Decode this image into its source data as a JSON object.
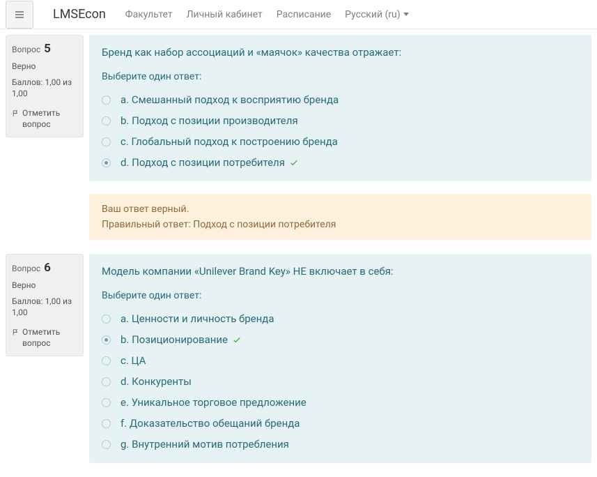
{
  "nav": {
    "brand": "LMSEcon",
    "links": {
      "faculty": "Факультет",
      "cabinet": "Личный кабинет",
      "schedule": "Расписание",
      "language": "Русский (ru)"
    }
  },
  "common": {
    "question_label": "Вопрос",
    "flag_label": "Отметить вопрос",
    "prompt": "Выберите один ответ:"
  },
  "questions": [
    {
      "number": "5",
      "status": "Верно",
      "score": "Баллов: 1,00 из 1,00",
      "text": "Бренд как набор ассоциаций и «маячок» качества отражает:",
      "options": [
        {
          "letter": "a.",
          "label": "Смешанный подход к восприятию бренда",
          "selected": false,
          "correct": false
        },
        {
          "letter": "b.",
          "label": "Подход с позиции производителя",
          "selected": false,
          "correct": false
        },
        {
          "letter": "c.",
          "label": "Глобальный подход к построению бренда",
          "selected": false,
          "correct": false
        },
        {
          "letter": "d.",
          "label": "Подход с позиции потребителя",
          "selected": true,
          "correct": true
        }
      ],
      "feedback": {
        "line1": "Ваш ответ верный.",
        "line2": "Правильный ответ: Подход с позиции потребителя"
      }
    },
    {
      "number": "6",
      "status": "Верно",
      "score": "Баллов: 1,00 из 1,00",
      "text": "Модель компании «Unilever Brand Key» НЕ включает в себя:",
      "options": [
        {
          "letter": "a.",
          "label": "Ценности и личность бренда",
          "selected": false,
          "correct": false
        },
        {
          "letter": "b.",
          "label": "Позиционирование",
          "selected": true,
          "correct": true
        },
        {
          "letter": "c.",
          "label": "ЦА",
          "selected": false,
          "correct": false
        },
        {
          "letter": "d.",
          "label": "Конкуренты",
          "selected": false,
          "correct": false
        },
        {
          "letter": "e.",
          "label": "Уникальное торговое предложение",
          "selected": false,
          "correct": false
        },
        {
          "letter": "f.",
          "label": "Доказательство обещаний бренда",
          "selected": false,
          "correct": false
        },
        {
          "letter": "g.",
          "label": "Внутренний мотив потребления",
          "selected": false,
          "correct": false
        }
      ],
      "feedback": null
    }
  ]
}
